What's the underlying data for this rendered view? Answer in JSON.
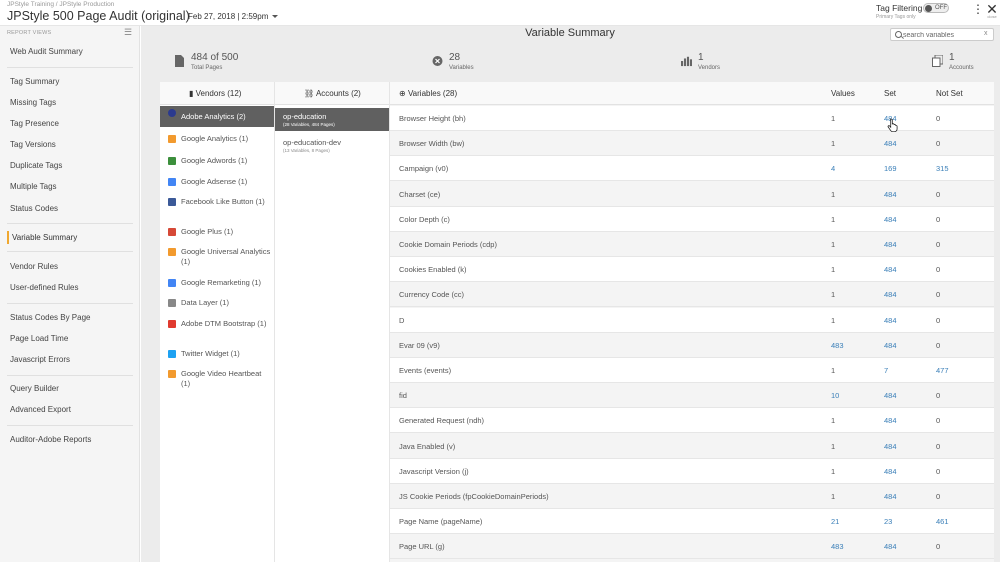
{
  "header": {
    "breadcrumb": "JPStyle Training / JPStyle Production",
    "title": "JPStyle 500 Page Audit (original)",
    "date": "Feb 27, 2018 | 2:59pm",
    "tag_filter_label": "Tag Filtering",
    "tag_filter_sub": "Primary Tags only",
    "toggle_state": "OFF",
    "close_label": "close"
  },
  "sidebar": {
    "heading": "REPORT VIEWS",
    "items": [
      {
        "label": "Web Audit Summary"
      },
      {
        "label": "Tag Summary"
      },
      {
        "label": "Missing Tags"
      },
      {
        "label": "Tag Presence"
      },
      {
        "label": "Tag Versions"
      },
      {
        "label": "Duplicate Tags"
      },
      {
        "label": "Multiple Tags"
      },
      {
        "label": "Status Codes"
      },
      {
        "label": "Variable Summary"
      },
      {
        "label": "Vendor Rules"
      },
      {
        "label": "User-defined Rules"
      },
      {
        "label": "Status Codes By Page"
      },
      {
        "label": "Page Load Time"
      },
      {
        "label": "Javascript Errors"
      },
      {
        "label": "Query Builder"
      },
      {
        "label": "Advanced Export"
      },
      {
        "label": "Auditor-Adobe Reports"
      }
    ]
  },
  "panel": {
    "title": "Variable Summary",
    "search_placeholder": "search variables",
    "search_clear": "x"
  },
  "stats": [
    {
      "value": "484 of 500",
      "label": "Total Pages"
    },
    {
      "value": "28",
      "label": "Variables"
    },
    {
      "value": "1",
      "label": "Vendors"
    },
    {
      "value": "1",
      "label": "Accounts"
    }
  ],
  "vendors_header": "Vendors (12)",
  "vendors": [
    {
      "name": "Adobe Analytics  (2)",
      "color": "#2b3a8f"
    },
    {
      "name": "Google Analytics  (1)",
      "color": "#f29a2e"
    },
    {
      "name": "Google Adwords  (1)",
      "color": "#3c8f3c"
    },
    {
      "name": "Google Adsense  (1)",
      "color": "#4285f4"
    },
    {
      "name": "Facebook Like Button (1)",
      "color": "#3b5998"
    },
    {
      "name": "Google Plus  (1)",
      "color": "#d64937"
    },
    {
      "name": "Google Universal Analytics  (1)",
      "color": "#f29a2e"
    },
    {
      "name": "Google Remarketing  (1)",
      "color": "#4285f4"
    },
    {
      "name": "Data Layer  (1)",
      "color": "#888888"
    },
    {
      "name": "Adobe DTM Bootstrap (1)",
      "color": "#e03a2f"
    },
    {
      "name": "Twitter Widget  (1)",
      "color": "#1da1f2"
    },
    {
      "name": "Google Video Heartbeat (1)",
      "color": "#f29a2e"
    }
  ],
  "accounts_header": "Accounts (2)",
  "accounts": [
    {
      "name": "op-education",
      "sub": "(28 Variables, 484 Pages)"
    },
    {
      "name": "op-education-dev",
      "sub": "(13 Variables, 8 Pages)"
    }
  ],
  "variables_header": "Variables (28)",
  "columns": {
    "values": "Values",
    "set": "Set",
    "not_set": "Not Set"
  },
  "variables": [
    {
      "name": "Browser Height (bh)",
      "values": "1",
      "set": "484",
      "not_set": "0"
    },
    {
      "name": "Browser Width (bw)",
      "values": "1",
      "set": "484",
      "not_set": "0"
    },
    {
      "name": "Campaign (v0)",
      "values": "4",
      "set": "169",
      "not_set": "315"
    },
    {
      "name": "Charset (ce)",
      "values": "1",
      "set": "484",
      "not_set": "0"
    },
    {
      "name": "Color Depth (c)",
      "values": "1",
      "set": "484",
      "not_set": "0"
    },
    {
      "name": "Cookie Domain Periods (cdp)",
      "values": "1",
      "set": "484",
      "not_set": "0"
    },
    {
      "name": "Cookies Enabled (k)",
      "values": "1",
      "set": "484",
      "not_set": "0"
    },
    {
      "name": "Currency Code (cc)",
      "values": "1",
      "set": "484",
      "not_set": "0"
    },
    {
      "name": "D",
      "values": "1",
      "set": "484",
      "not_set": "0"
    },
    {
      "name": "Evar 09 (v9)",
      "values": "483",
      "set": "484",
      "not_set": "0"
    },
    {
      "name": "Events (events)",
      "values": "1",
      "set": "7",
      "not_set": "477"
    },
    {
      "name": "fid",
      "values": "10",
      "set": "484",
      "not_set": "0"
    },
    {
      "name": "Generated Request (ndh)",
      "values": "1",
      "set": "484",
      "not_set": "0"
    },
    {
      "name": "Java Enabled (v)",
      "values": "1",
      "set": "484",
      "not_set": "0"
    },
    {
      "name": "Javascript Version (j)",
      "values": "1",
      "set": "484",
      "not_set": "0"
    },
    {
      "name": "JS Cookie Periods (fpCookieDomainPeriods)",
      "values": "1",
      "set": "484",
      "not_set": "0"
    },
    {
      "name": "Page Name (pageName)",
      "values": "21",
      "set": "23",
      "not_set": "461"
    },
    {
      "name": "Page URL (g)",
      "values": "483",
      "set": "484",
      "not_set": "0"
    }
  ]
}
